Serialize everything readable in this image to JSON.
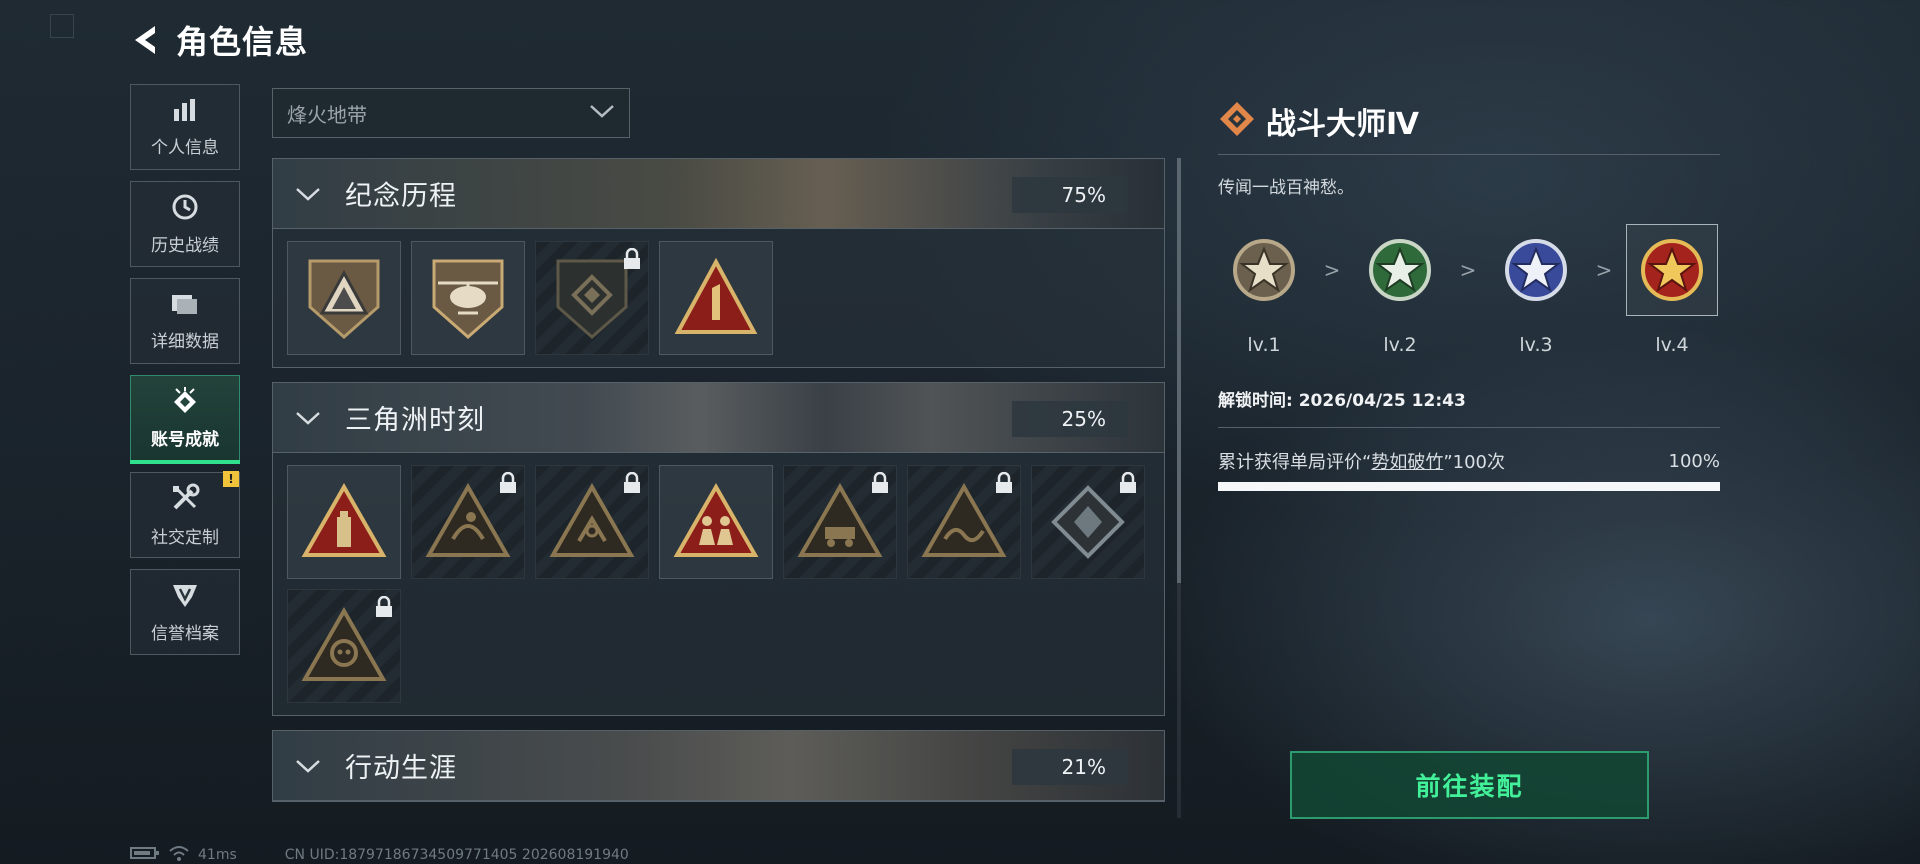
{
  "header": {
    "title": "角色信息"
  },
  "sidebar": {
    "items": [
      {
        "label": "个人信息",
        "icon": "bar-chart-icon",
        "active": false
      },
      {
        "label": "历史战绩",
        "icon": "clock-icon",
        "active": false
      },
      {
        "label": "详细数据",
        "icon": "folder-icon",
        "active": false
      },
      {
        "label": "账号成就",
        "icon": "achievement-icon",
        "active": true
      },
      {
        "label": "社交定制",
        "icon": "tools-icon",
        "active": false,
        "badge": "!"
      },
      {
        "label": "信誉档案",
        "icon": "shield-icon",
        "active": false
      }
    ]
  },
  "mode_select": {
    "value": "烽火地带"
  },
  "sections": [
    {
      "title": "纪念历程",
      "percent": "75%"
    },
    {
      "title": "三角洲时刻",
      "percent": "25%"
    },
    {
      "title": "行动生涯",
      "percent": "21%"
    }
  ],
  "detail": {
    "title": "战斗大师Ⅳ",
    "description": "传闻一战百神愁。",
    "levels": [
      "lv.1",
      "lv.2",
      "lv.3",
      "lv.4"
    ],
    "separator": ">",
    "unlock_time": "解锁时间: 2026/04/25 12:43",
    "requirement_prefix": "累计获得单局评价“",
    "requirement_keyword": "势如破竹",
    "requirement_suffix": "”100次",
    "requirement_progress": "100%",
    "progress_fraction": 1.0
  },
  "equip_button": {
    "label": "前往装配"
  },
  "footer": {
    "ping": "41ms",
    "uid": "CN UID:18797186734509771405 202608191940"
  },
  "colors": {
    "accent_green": "#43f09a",
    "active_bar": "#2fe08c",
    "badge_yellow": "#f0c33a",
    "medal_orange": "#e2874a"
  }
}
